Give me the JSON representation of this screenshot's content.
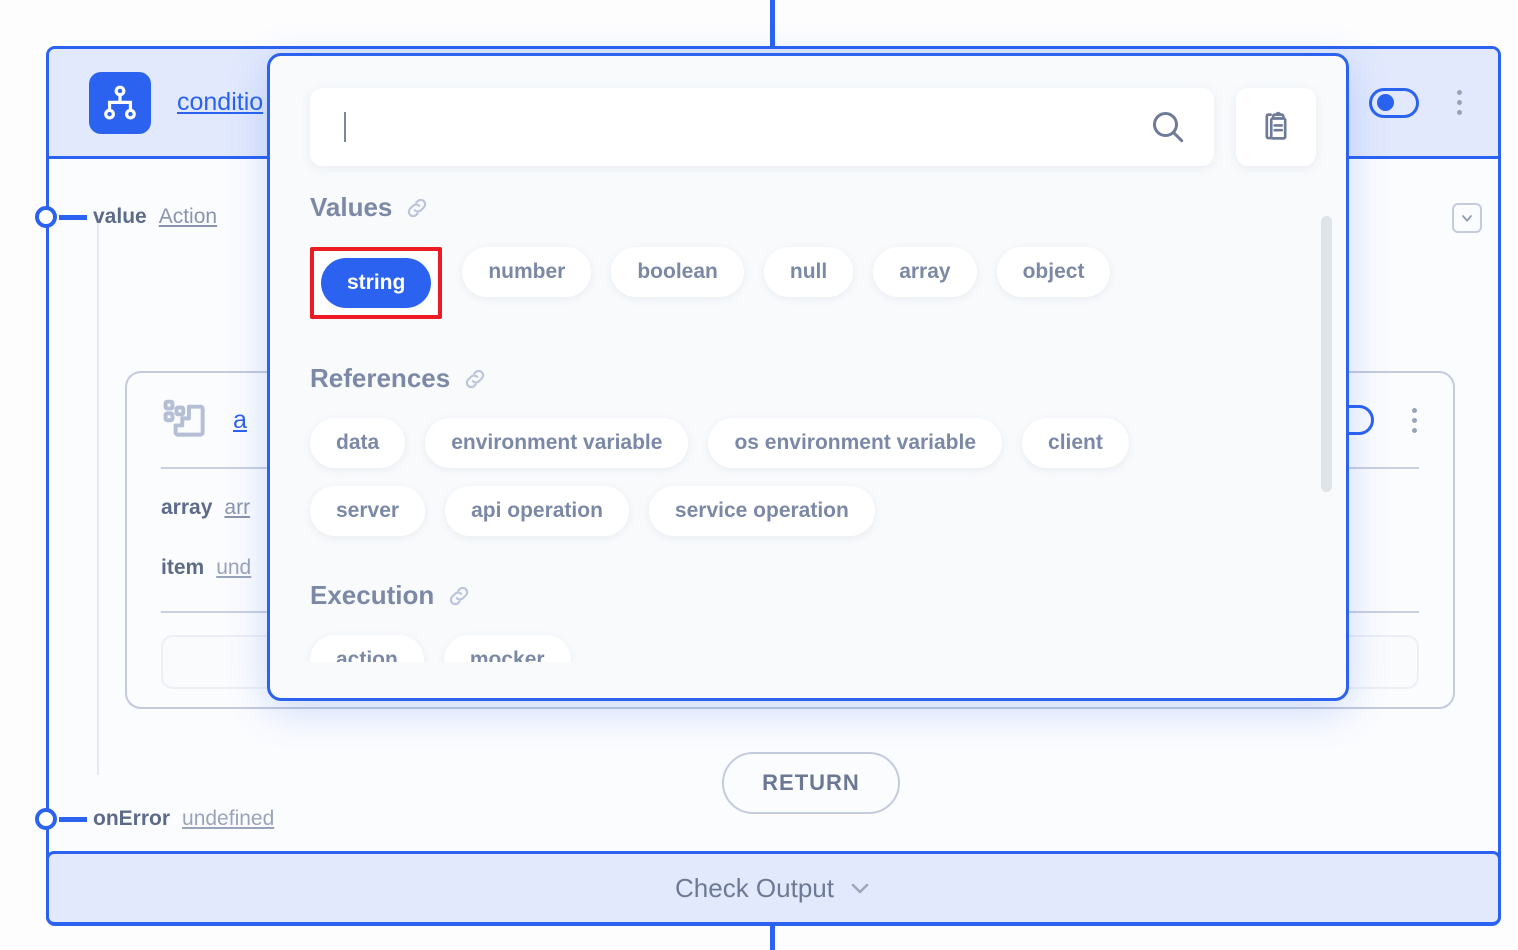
{
  "node": {
    "icon": "condition-hierarchy-icon",
    "title": "conditio",
    "ports": [
      {
        "label": "value",
        "value": "Action"
      },
      {
        "label": "onError",
        "value": "undefined"
      }
    ],
    "inner": {
      "icon": "array-blocks-icon",
      "title": "a",
      "rows": [
        {
          "label": "array",
          "value": "arr"
        },
        {
          "label": "item",
          "value": "und"
        }
      ]
    },
    "return_label": "RETURN",
    "check_output_label": "Check Output",
    "chevron_icon": "chevron-down-icon",
    "collapse_icon": "chevron-down-icon",
    "kebab_icon": "kebab-menu-icon",
    "toggle_icon": "toggle-switch-on"
  },
  "popup": {
    "search": {
      "value": "",
      "placeholder": "",
      "search_icon": "search-icon",
      "clipboard_icon": "clipboard-paste-icon"
    },
    "sections": [
      {
        "title": "Values",
        "link_icon": "link-chain-icon",
        "rows": [
          [
            "string",
            "number",
            "boolean",
            "null",
            "array",
            "object"
          ]
        ],
        "selected": "string"
      },
      {
        "title": "References",
        "link_icon": "link-chain-icon",
        "rows": [
          [
            "data",
            "environment variable",
            "os environment variable",
            "client"
          ],
          [
            "server",
            "api operation",
            "service operation"
          ]
        ],
        "selected": null
      },
      {
        "title": "Execution",
        "link_icon": "link-chain-icon",
        "rows": [
          [
            "action",
            "mocker"
          ]
        ],
        "selected": null
      }
    ]
  },
  "colors": {
    "accent": "#2b63f0",
    "accent_soft": "#e2e9fd",
    "highlight_box": "#ed1c24",
    "text_muted": "#7c89a6",
    "panel_bg": "#f8fafc",
    "chip_bg": "#ffffff"
  }
}
